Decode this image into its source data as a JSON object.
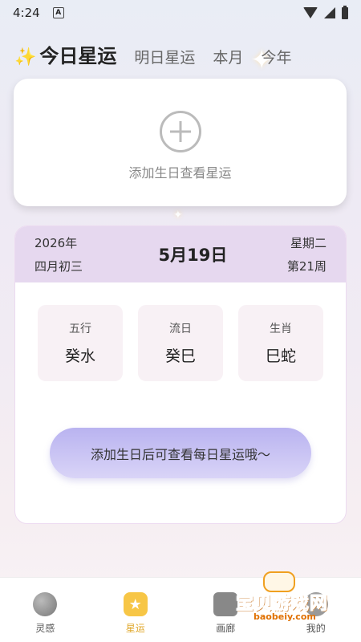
{
  "status_bar": {
    "time": "4:24",
    "notification_icon": "A"
  },
  "tabs": [
    {
      "label": "今日星运",
      "active": true
    },
    {
      "label": "明日星运",
      "active": false
    },
    {
      "label": "本月",
      "active": false
    },
    {
      "label": "今年",
      "active": false
    }
  ],
  "add_card": {
    "text": "添加生日查看星运",
    "icon": "plus-circle-icon"
  },
  "date_card": {
    "year": "2026年",
    "lunar_date": "四月初三",
    "date": "5月19日",
    "weekday": "星期二",
    "week_number": "第21周",
    "boxes": [
      {
        "label": "五行",
        "value": "癸水"
      },
      {
        "label": "流日",
        "value": "癸巳"
      },
      {
        "label": "生肖",
        "value": "巳蛇"
      }
    ],
    "cta": "添加生日后可查看每日星运哦～"
  },
  "bottom_nav": [
    {
      "label": "灵感",
      "icon": "planet-icon",
      "active": false
    },
    {
      "label": "星运",
      "icon": "star-icon",
      "active": true
    },
    {
      "label": "画廊",
      "icon": "gallery-icon",
      "active": false
    },
    {
      "label": "我的",
      "icon": "profile-icon",
      "active": false
    }
  ],
  "watermark": {
    "title": "宝贝游戏网",
    "url": "baobeiy.com"
  },
  "colors": {
    "accent": "#f7c646",
    "header_bg": "#e6d8ef",
    "cta_gradient_start": "#b9b3f0",
    "cta_gradient_end": "#d9d4f7"
  }
}
